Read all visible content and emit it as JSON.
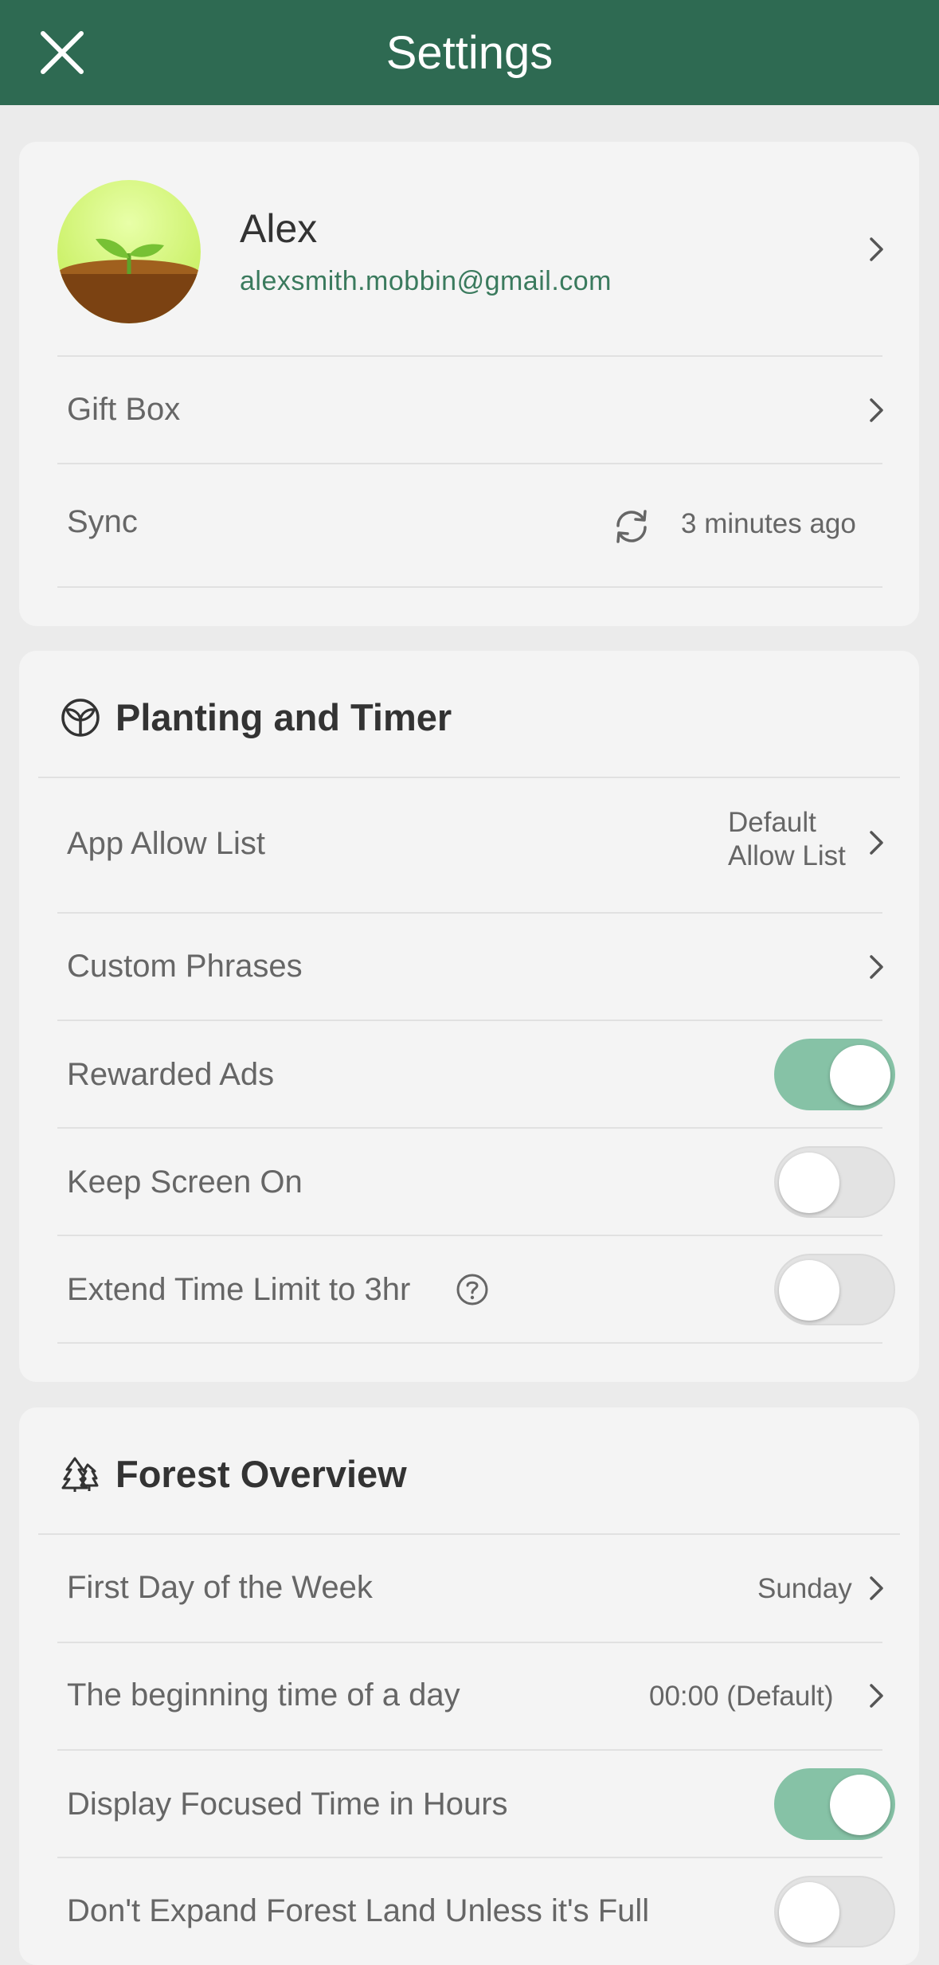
{
  "header": {
    "title": "Settings"
  },
  "profile": {
    "name": "Alex",
    "email": "alexsmith.mobbin@gmail.com"
  },
  "account": {
    "gift_box_label": "Gift Box",
    "sync_label": "Sync",
    "sync_status": "3 minutes ago"
  },
  "planting": {
    "title": "Planting and Timer",
    "app_allow_list_label": "App Allow List",
    "app_allow_list_value_line1": "Default",
    "app_allow_list_value_line2": "Allow List",
    "custom_phrases_label": "Custom Phrases",
    "rewarded_ads_label": "Rewarded Ads",
    "rewarded_ads_on": true,
    "keep_screen_on_label": "Keep Screen On",
    "keep_screen_on_on": false,
    "extend_time_label": "Extend Time Limit to 3hr",
    "extend_time_on": false
  },
  "forest": {
    "title": "Forest Overview",
    "first_day_label": "First Day of the Week",
    "first_day_value": "Sunday",
    "begin_time_label": "The beginning time of a day",
    "begin_time_value": "00:00 (Default)",
    "display_hours_label": "Display Focused Time in Hours",
    "display_hours_on": true,
    "dont_expand_label": "Don't Expand Forest Land Unless it's Full",
    "dont_expand_on": false
  },
  "colors": {
    "brand": "#2e6a52",
    "toggle_on": "#86c2a6",
    "email": "#3a7a5d"
  }
}
